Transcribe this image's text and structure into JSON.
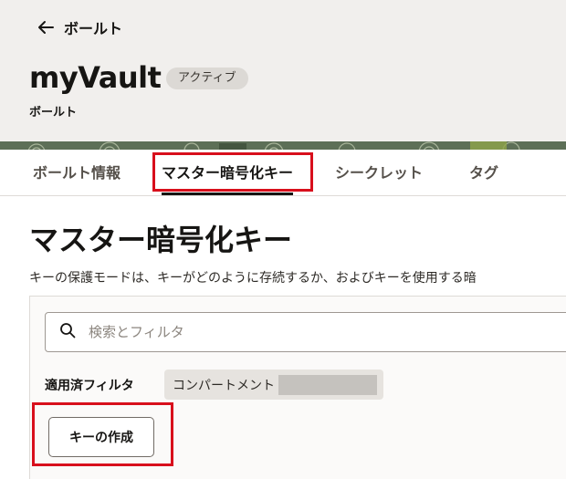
{
  "header": {
    "back_label": "ボールト",
    "title": "myVault",
    "status_badge": "アクティブ",
    "subtitle": "ボールト"
  },
  "tabs": [
    {
      "label": "ボールト情報"
    },
    {
      "label": "マスター暗号化キー"
    },
    {
      "label": "シークレット"
    },
    {
      "label": "タグ"
    }
  ],
  "active_tab": "マスター暗号化キー",
  "main": {
    "page_title": "マスター暗号化キー",
    "description": "キーの保護モードは、キーがどのように存続するか、およびキーを使用する暗"
  },
  "search": {
    "placeholder": "検索とフィルタ",
    "value": ""
  },
  "filters": {
    "label": "適用済フィルタ",
    "chip_label": "コンパートメント"
  },
  "actions": {
    "create_key_label": "キーの作成"
  },
  "icons": {
    "back": "arrow-left-icon",
    "search": "search-icon"
  },
  "colors": {
    "highlight": "#d80f1c",
    "header_bg": "#f1efed",
    "band": "#5d6f57"
  }
}
